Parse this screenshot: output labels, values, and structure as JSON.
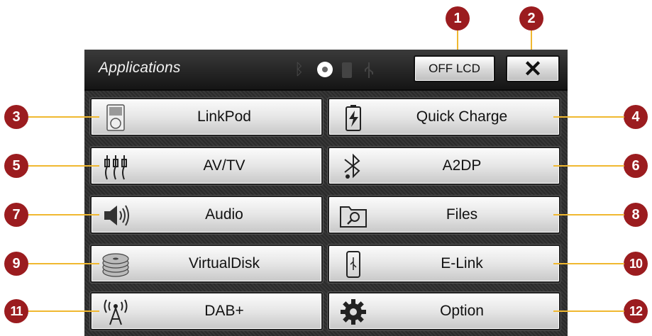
{
  "header": {
    "title": "Applications",
    "off_lcd_label": "OFF LCD",
    "close_label": "✕",
    "status_icons": [
      "bluetooth-icon",
      "disc-icon",
      "phone-icon",
      "usb-icon"
    ]
  },
  "apps": [
    {
      "label": "LinkPod",
      "icon": "ipod-icon"
    },
    {
      "label": "Quick Charge",
      "icon": "battery-charge-icon"
    },
    {
      "label": "AV/TV",
      "icon": "av-cable-icon"
    },
    {
      "label": "A2DP",
      "icon": "bluetooth-music-icon"
    },
    {
      "label": "Audio",
      "icon": "speaker-icon"
    },
    {
      "label": "Files",
      "icon": "folder-search-icon"
    },
    {
      "label": "VirtualDisk",
      "icon": "disc-stack-icon"
    },
    {
      "label": "E-Link",
      "icon": "phone-usb-icon"
    },
    {
      "label": "DAB+",
      "icon": "radio-antenna-icon"
    },
    {
      "label": "Option",
      "icon": "gear-icon"
    }
  ],
  "callouts": [
    "1",
    "2",
    "3",
    "4",
    "5",
    "6",
    "7",
    "8",
    "9",
    "10",
    "11",
    "12"
  ],
  "colors": {
    "callout": "#9b1c1f",
    "leader_line": "#f0b830",
    "screen_bg": "#2f2f2f"
  }
}
